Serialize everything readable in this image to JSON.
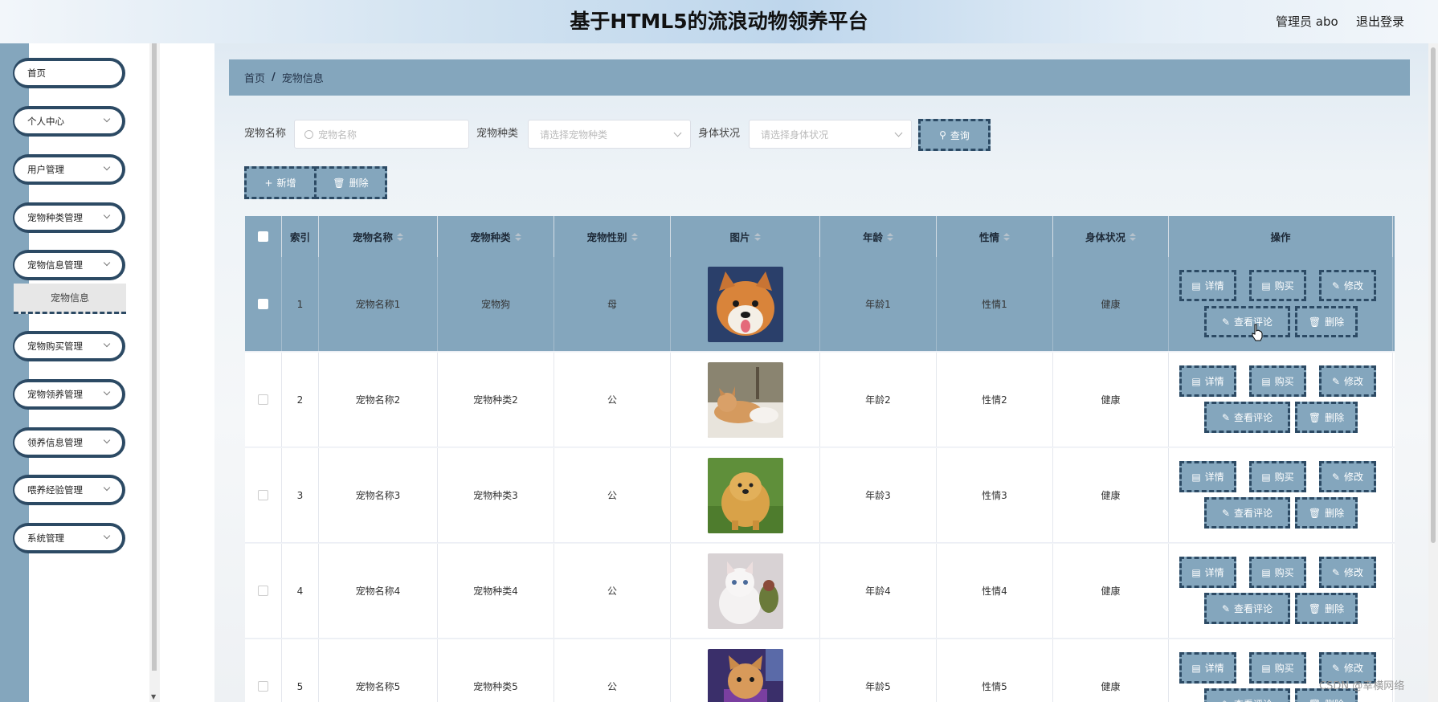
{
  "header": {
    "title": "基于HTML5的流浪动物领养平台",
    "user": "管理员 abo",
    "logout": "退出登录"
  },
  "sidebar": {
    "items": [
      {
        "label": "首页",
        "has_arrow": false
      },
      {
        "label": "个人中心",
        "has_arrow": true
      },
      {
        "label": "用户管理",
        "has_arrow": true
      },
      {
        "label": "宠物种类管理",
        "has_arrow": true
      },
      {
        "label": "宠物信息管理",
        "has_arrow": true
      },
      {
        "label": "宠物购买管理",
        "has_arrow": true
      },
      {
        "label": "宠物领养管理",
        "has_arrow": true
      },
      {
        "label": "领养信息管理",
        "has_arrow": true
      },
      {
        "label": "喂养经验管理",
        "has_arrow": true
      },
      {
        "label": "系统管理",
        "has_arrow": true
      }
    ],
    "submenu": "宠物信息"
  },
  "breadcrumb": {
    "home": "首页",
    "separator": "/",
    "current": "宠物信息"
  },
  "search": {
    "name_label": "宠物名称",
    "name_placeholder": "宠物名称",
    "type_label": "宠物种类",
    "type_placeholder": "请选择宠物种类",
    "health_label": "身体状况",
    "health_placeholder": "请选择身体状况",
    "query_button": "查询"
  },
  "actions": {
    "add_button": "新增",
    "delete_button": "删除"
  },
  "table": {
    "headers": [
      "索引",
      "宠物名称",
      "宠物种类",
      "宠物性别",
      "图片",
      "年龄",
      "性情",
      "身体状况",
      "操作"
    ],
    "row_actions": [
      "详情",
      "购买",
      "修改",
      "查看评论",
      "删除"
    ],
    "rows": [
      {
        "index": "1",
        "name": "宠物名称1",
        "type": "宠物狗",
        "gender": "母",
        "image": "shiba-dog",
        "age": "年龄1",
        "temper": "性情1",
        "health": "健康",
        "selected": true
      },
      {
        "index": "2",
        "name": "宠物名称2",
        "type": "宠物种类2",
        "gender": "公",
        "image": "orange-kitten",
        "age": "年龄2",
        "temper": "性情2",
        "health": "健康",
        "selected": false
      },
      {
        "index": "3",
        "name": "宠物名称3",
        "type": "宠物种类3",
        "gender": "公",
        "image": "chow-chow-dog",
        "age": "年龄3",
        "temper": "性情3",
        "health": "健康",
        "selected": false
      },
      {
        "index": "4",
        "name": "宠物名称4",
        "type": "宠物种类4",
        "gender": "公",
        "image": "white-kitten",
        "age": "年龄4",
        "temper": "性情4",
        "health": "健康",
        "selected": false
      },
      {
        "index": "5",
        "name": "宠物名称5",
        "type": "宠物种类5",
        "gender": "公",
        "image": "cat-purple",
        "age": "年龄5",
        "temper": "性情5",
        "health": "健康",
        "selected": false
      }
    ]
  },
  "watermark": "CSDN @幸横网络",
  "colors": {
    "accent": "#84a6bd",
    "border_dark": "#2c4a64"
  }
}
